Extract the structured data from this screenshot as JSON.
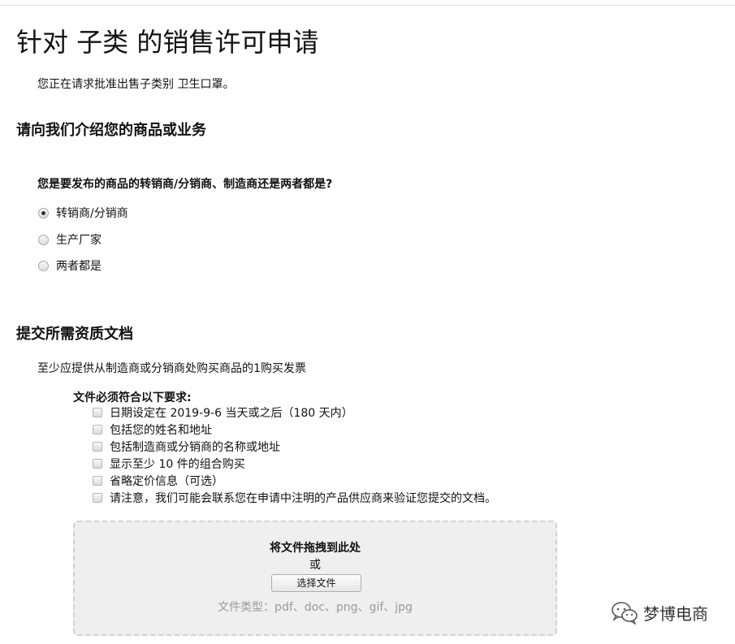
{
  "page": {
    "title": "针对 子类 的销售许可申请",
    "intro": "您正在请求批准出售子类别 卫生口罩。"
  },
  "section1": {
    "heading": "请向我们介绍您的商品或业务",
    "question": "您是要发布的商品的转销商/分销商、制造商还是两者都是?",
    "options": [
      {
        "label": "转销商/分销商",
        "selected": true
      },
      {
        "label": "生产厂家",
        "selected": false
      },
      {
        "label": "两者都是",
        "selected": false
      }
    ]
  },
  "section2": {
    "heading": "提交所需资质文档",
    "intro": "至少应提供从制造商或分销商处购买商品的1购买发票",
    "requirements_title": "文件必须符合以下要求:",
    "requirements": [
      "日期设定在 2019-9-6 当天或之后（180 天内）",
      "包括您的姓名和地址",
      "包括制造商或分销商的名称或地址",
      "显示至少 10 件的组合购买",
      "省略定价信息（可选）",
      "请注意，我们可能会联系您在申请中注明的产品供应商来验证您提交的文档。"
    ],
    "upload": {
      "drop_text": "将文件拖拽到此处",
      "or_text": "或",
      "button_label": "选择文件",
      "file_types": "文件类型：pdf、doc、png、gif、jpg"
    }
  },
  "watermark": {
    "text": "梦博电商",
    "icon": "wechat-icon"
  }
}
